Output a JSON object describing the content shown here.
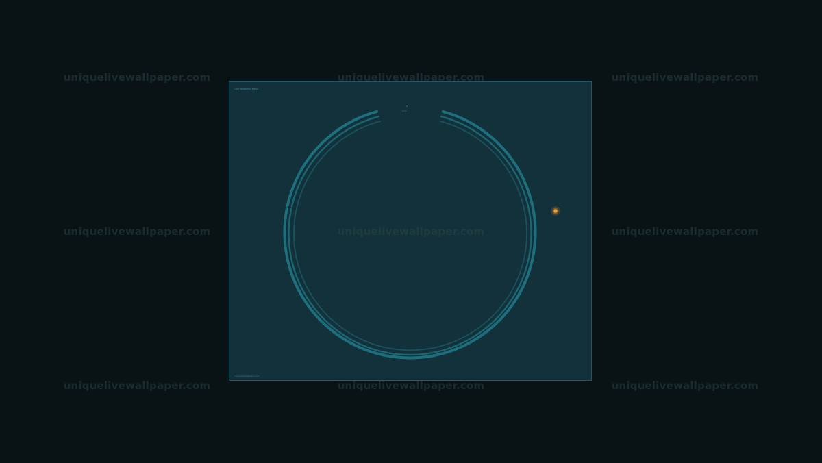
{
  "watermarks": [
    "uniquelivewallpaper.com",
    "uniquelivewallpaper.com",
    "uniquelivewallpaper.com",
    "uniquelivewallpaper.com",
    "uniquelivewallpaper.com",
    "uniquelivewallpaper.com",
    "uniquelivewallpaper.com",
    "uniquelivewallpaper.com",
    "uniquelivewallpaper.com"
  ],
  "panel": {
    "title": "LIVE MAGNETIC FIELD",
    "footer": "uniquelivewallpaper.com",
    "ring_labels": {
      "top": "N",
      "top_sub": "0 km",
      "upper_right": "",
      "upper_left": "",
      "lower_left": "",
      "lower_right": "",
      "bottom": "",
      "marker": ""
    }
  },
  "colors": {
    "background": "#091315",
    "panel": "#12313b",
    "ring": "#1e6f7d",
    "ring_dark": "#1a4f5b",
    "marker": "#e08a2a"
  }
}
